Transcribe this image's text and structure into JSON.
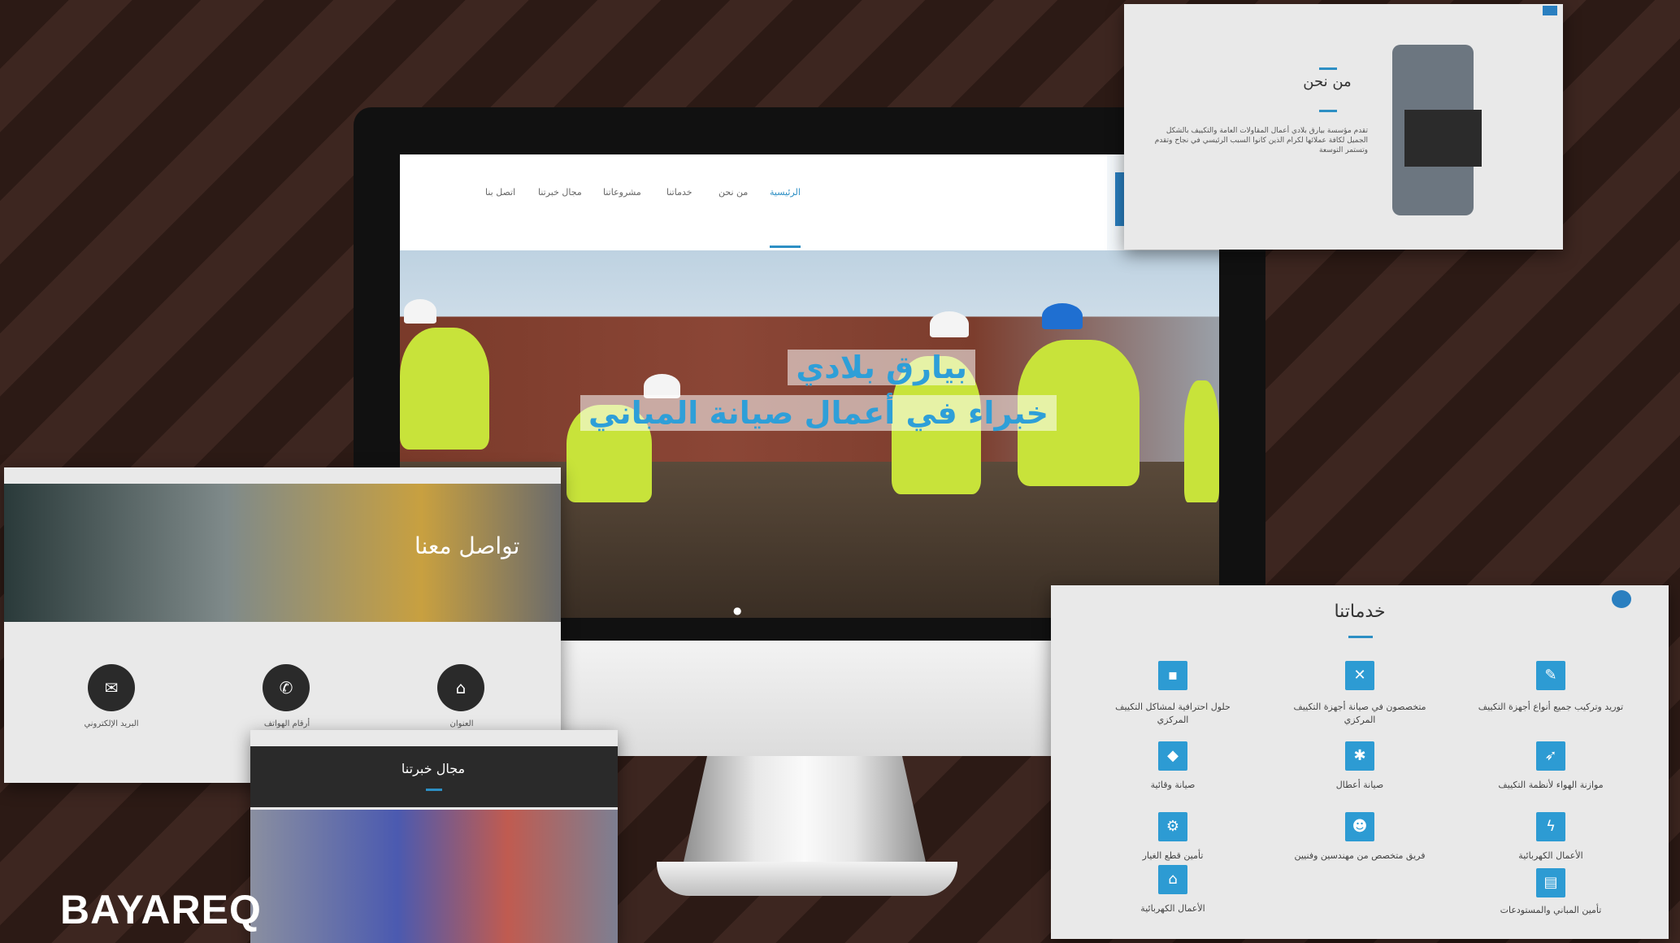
{
  "brand": "BAYAREQ",
  "main_site": {
    "nav": [
      "الرئيسية",
      "من نحن",
      "خدماتنا",
      "مشروعاتنا",
      "مجال خبرتنا",
      "اتصل بنا"
    ],
    "hero_title": "بيارق بلادي",
    "hero_subtitle": "خبراء في أعمال صيانة المباني",
    "slider_dots": "● ●"
  },
  "about_panel": {
    "title": "من نحن",
    "body": "تقدم مؤسسة بيارق بلادي أعمال المقاولات العامة والتكييف بالشكل الجميل لكافة عملائها لكرام الذين كانوا السبب الرئيسي في نجاح وتقدم وتستمر التوسعة"
  },
  "contact_panel": {
    "title": "تواصل معنا",
    "items": [
      {
        "icon": "envelope-icon",
        "glyph": "✉",
        "label": "البريد الإلكتروني"
      },
      {
        "icon": "phone-icon",
        "glyph": "✆",
        "label": "أرقام الهواتف"
      },
      {
        "icon": "map-icon",
        "glyph": "⌂",
        "label": "العنوان"
      }
    ]
  },
  "expertise_panel": {
    "title": "مجال خبرتنا"
  },
  "services_panel": {
    "title": "خدماتنا",
    "services": [
      {
        "icon": "wrench-icon",
        "glyph": "✎",
        "label": "توريد وتركيب جميع أنواع أجهزة التكييف"
      },
      {
        "icon": "tools-icon",
        "glyph": "✕",
        "label": "متخصصون في صيانة أجهزة التكييف المركزي"
      },
      {
        "icon": "drill-icon",
        "glyph": "▪",
        "label": "حلول احترافية لمشاكل التكييف المركزي"
      },
      {
        "icon": "air-balance-icon",
        "glyph": "➶",
        "label": "موازنة الهواء لأنظمة التكييف"
      },
      {
        "icon": "fault-icon",
        "glyph": "✱",
        "label": "صيانة أعطال"
      },
      {
        "icon": "shield-icon",
        "glyph": "◆",
        "label": "صيانة وقائية"
      },
      {
        "icon": "lightning-icon",
        "glyph": "ϟ",
        "label": "الأعمال الكهربائية"
      },
      {
        "icon": "team-icon",
        "glyph": "☻",
        "label": "فريق متخصص من مهندسين وفنيين"
      },
      {
        "icon": "spare-parts-icon",
        "glyph": "⚙",
        "label": "تأمين قطع الغيار"
      },
      {
        "icon": "building-icon",
        "glyph": "▤",
        "label": "تأمين المباني والمستودعات"
      },
      {
        "icon": "electric-icon",
        "glyph": "⌂",
        "label": "الأعمال الكهربائية"
      }
    ]
  }
}
